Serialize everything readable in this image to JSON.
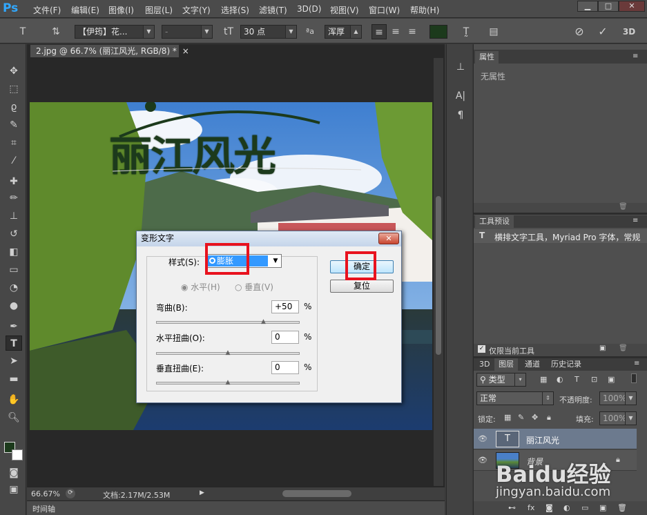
{
  "menubar": {
    "logo": "Ps",
    "items": [
      "文件(F)",
      "编辑(E)",
      "图像(I)",
      "图层(L)",
      "文字(Y)",
      "选择(S)",
      "滤镜(T)",
      "3D(D)",
      "视图(V)",
      "窗口(W)",
      "帮助(H)"
    ]
  },
  "options": {
    "font_family": "【伊筠】花...",
    "font_style": "-",
    "font_size": "30 点",
    "aa_mode": "浑厚",
    "text_color": "#1c3a1c"
  },
  "document": {
    "tab_title": "2.jpg @ 66.7% (丽江风光, RGB/8) *",
    "canvas_text": "丽江风光",
    "zoom": "66.67%",
    "doc_size": "文档:2.17M/2.53M",
    "timeline_label": "时间轴"
  },
  "dialog": {
    "title": "变形文字",
    "style_label": "样式(S):",
    "style_value": "膨胀",
    "horizontal_label": "水平(H)",
    "vertical_label": "垂直(V)",
    "bend_label": "弯曲(B):",
    "bend_value": "+50",
    "hdist_label": "水平扭曲(O):",
    "hdist_value": "0",
    "vdist_label": "垂直扭曲(E):",
    "vdist_value": "0",
    "percent": "%",
    "ok_label": "确定",
    "reset_label": "复位",
    "bend_level": 0.75,
    "hdist_level": 0.5,
    "vdist_level": 0.5
  },
  "properties": {
    "tab": "属性",
    "empty_text": "无属性"
  },
  "tool_presets": {
    "tab": "工具预设",
    "item": "横排文字工具，Myriad Pro 字体，常规",
    "current_only": "仅限当前工具"
  },
  "layers": {
    "tabs": [
      "3D",
      "图层",
      "通道",
      "历史记录"
    ],
    "filter_label": "类型",
    "blend_mode": "正常",
    "opacity_label": "不透明度:",
    "opacity_value": "100%",
    "lock_label": "锁定:",
    "fill_label": "填充:",
    "fill_value": "100%",
    "rows": [
      {
        "name": "丽江风光",
        "thumb": "T"
      },
      {
        "name": "背景",
        "thumb": ""
      }
    ]
  },
  "watermark": {
    "brand": "Baidu经验",
    "url": "jingyan.baidu.com"
  },
  "colors": {
    "accent_red": "#e8121e",
    "selection_blue": "#3399ff",
    "ps_blue": "#31a8ff"
  }
}
